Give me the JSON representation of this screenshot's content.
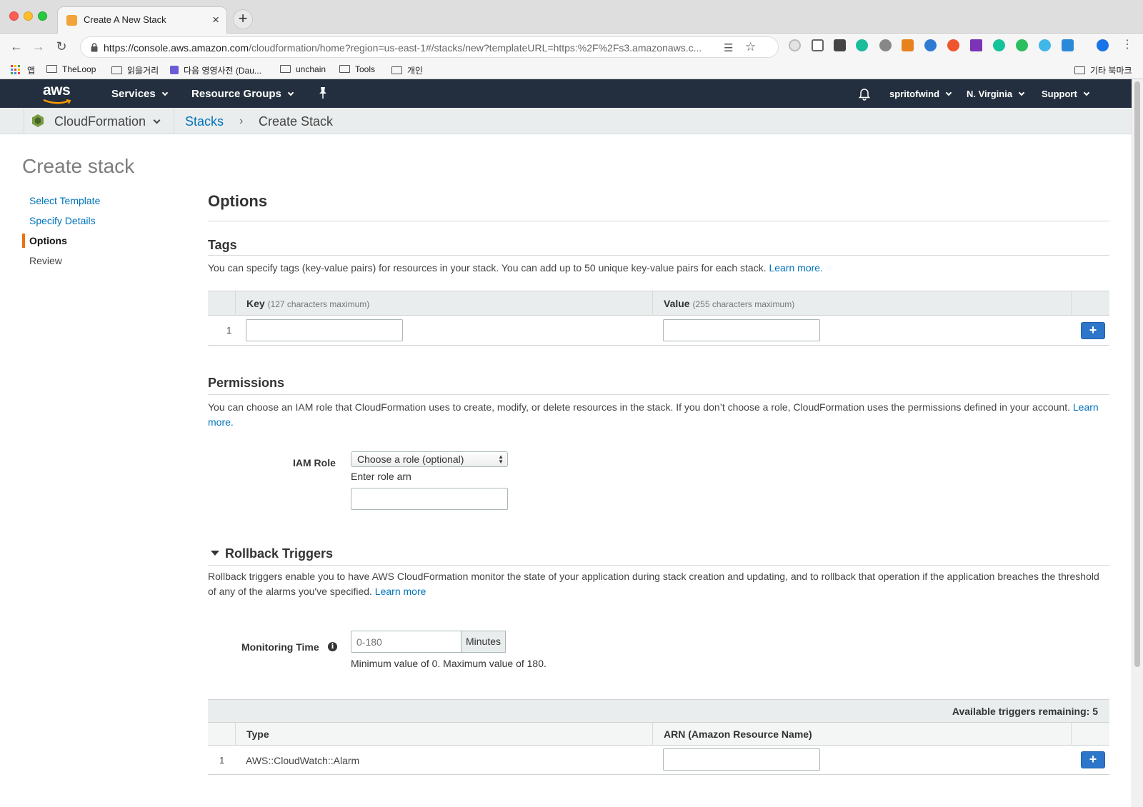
{
  "browser": {
    "tab_title": "Create A New Stack",
    "tab_close": "×",
    "new_tab": "+",
    "url_host": "https://console.aws.amazon.com",
    "url_path": "/cloudformation/home?region=us-east-1#/stacks/new?templateURL=https:%2F%2Fs3.amazonaws.c...",
    "bookmarks": [
      "앱",
      "TheLoop",
      "읽을거리",
      "다음 영영사전 (Dau...",
      "unchain",
      "Tools",
      "개인"
    ],
    "other_bookmarks": "기타 북마크"
  },
  "awsnav": {
    "logo": "aws",
    "services": "Services",
    "resource_groups": "Resource Groups",
    "user": "spritofwind",
    "region": "N. Virginia",
    "support": "Support"
  },
  "servicebar": {
    "service": "CloudFormation",
    "crumb_stacks": "Stacks",
    "crumb_sep": "›",
    "crumb_current": "Create Stack"
  },
  "page": {
    "title": "Create stack",
    "steps": [
      {
        "label": "Select Template",
        "state": "link"
      },
      {
        "label": "Specify Details",
        "state": "link"
      },
      {
        "label": "Options",
        "state": "active"
      },
      {
        "label": "Review",
        "state": "plain"
      }
    ]
  },
  "options": {
    "heading": "Options",
    "tags": {
      "heading": "Tags",
      "description": "You can specify tags (key-value pairs) for resources in your stack. You can add up to 50 unique key-value pairs for each stack.",
      "learn_more": "Learn more.",
      "key_header": "Key",
      "key_sub": "(127 characters maximum)",
      "value_header": "Value",
      "value_sub": "(255 characters maximum)",
      "row_number": "1",
      "add_button": "+"
    },
    "permissions": {
      "heading": "Permissions",
      "description": "You can choose an IAM role that CloudFormation uses to create, modify, or delete resources in the stack. If you don’t choose a role, CloudFormation uses the permissions defined in your account.",
      "learn_more": "Learn more.",
      "iam_role_label": "IAM Role",
      "iam_role_select": "Choose a role (optional)",
      "enter_role_arn": "Enter role arn"
    },
    "rollback": {
      "heading": "Rollback Triggers",
      "description": "Rollback triggers enable you to have AWS CloudFormation monitor the state of your application during stack creation and updating, and to rollback that operation if the application breaches the threshold of any of the alarms you've specified.",
      "learn_more": "Learn more",
      "monitoring_label": "Monitoring Time",
      "monitoring_placeholder": "0-180",
      "minutes_addon": "Minutes",
      "monitoring_help": "Minimum value of 0. Maximum value of 180.",
      "triggers_remaining": "Available triggers remaining: 5",
      "type_header": "Type",
      "arn_header": "ARN (Amazon Resource Name)",
      "row_number": "1",
      "row_type": "AWS::CloudWatch::Alarm",
      "add_button": "+"
    }
  },
  "colors": {
    "aws_nav": "#232f3e",
    "link": "#0073bb",
    "active_step": "#ec7211",
    "plus_button": "#2d76c9"
  }
}
